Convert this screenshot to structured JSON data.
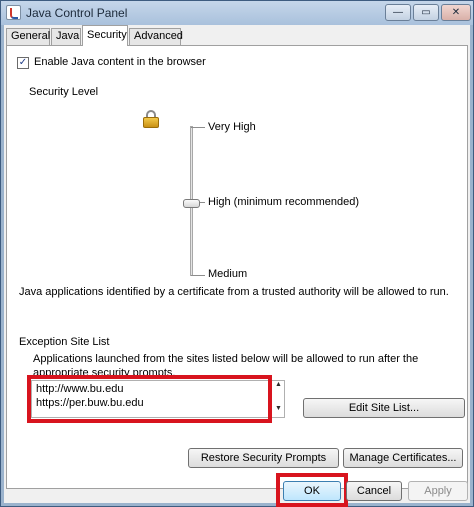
{
  "window": {
    "title": "Java Control Panel",
    "minimize_glyph": "—",
    "maximize_glyph": "▭",
    "close_glyph": "✕"
  },
  "tabs": [
    {
      "label": "General",
      "active": false
    },
    {
      "label": "Java",
      "active": false
    },
    {
      "label": "Security",
      "active": true
    },
    {
      "label": "Advanced",
      "active": false
    }
  ],
  "security": {
    "enable_checked": true,
    "check_glyph": "✓",
    "enable_label": "Enable Java content in the browser",
    "security_level_label": "Security Level",
    "levels": {
      "top": "Very High",
      "middle": "High (minimum recommended)",
      "bottom": "Medium"
    },
    "selected_level": "High (minimum recommended)",
    "certificate_text": "Java applications identified by a certificate from a trusted authority will be allowed to run."
  },
  "exception_sites": {
    "title": "Exception Site List",
    "description": "Applications launched from the sites listed below will be allowed to run after the appropriate security prompts.",
    "sites": [
      "http://www.bu.edu",
      "https://per.buw.bu.edu"
    ],
    "scroll_up_glyph": "▲",
    "scroll_down_glyph": "▼",
    "edit_button": "Edit Site List..."
  },
  "actions": {
    "restore_prompts": "Restore Security Prompts",
    "manage_certificates": "Manage Certificates..."
  },
  "dialog_buttons": {
    "ok": "OK",
    "cancel": "Cancel",
    "apply": "Apply"
  },
  "colors": {
    "highlight": "#d8141e",
    "title_bar": "#b7cbe2",
    "accent_ok": "#3c7fb1"
  },
  "icons": [
    "java-app-icon",
    "padlock-icon"
  ]
}
